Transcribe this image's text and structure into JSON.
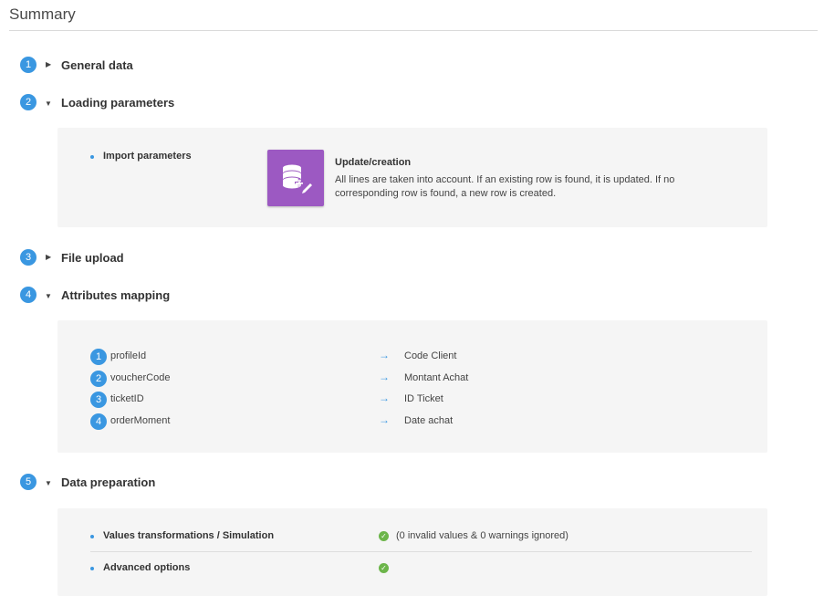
{
  "page": {
    "title": "Summary"
  },
  "sections": [
    {
      "number": "1",
      "title": "General data"
    },
    {
      "number": "2",
      "title": "Loading parameters"
    },
    {
      "number": "3",
      "title": "File upload"
    },
    {
      "number": "4",
      "title": "Attributes mapping"
    },
    {
      "number": "5",
      "title": "Data preparation"
    }
  ],
  "loading": {
    "label": "Import parameters",
    "mode_title": "Update/creation",
    "mode_desc_line1": "All lines are taken into account. If an existing row is found, it is updated. If no",
    "mode_desc_line2": "corresponding row is found, a new row is created."
  },
  "mapping": [
    {
      "number": "1",
      "source": "profileId",
      "target": "Code Client"
    },
    {
      "number": "2",
      "source": "voucherCode",
      "target": "Montant Achat"
    },
    {
      "number": "3",
      "source": "ticketID",
      "target": "ID Ticket"
    },
    {
      "number": "4",
      "source": "orderMoment",
      "target": "Date achat"
    }
  ],
  "preparation": {
    "rows": [
      {
        "label": "Values transformations / Simulation",
        "value": "(0 invalid values & 0 warnings ignored)"
      },
      {
        "label": "Advanced options",
        "value": ""
      }
    ]
  },
  "icons": {
    "caret_collapsed": "caret-right-icon",
    "caret_expanded": "caret-down-icon",
    "arrow": "arrow-right-icon",
    "check": "check-circle-icon",
    "import_mode": "database-plus-edit-icon"
  },
  "colors": {
    "accent": "#3a97e1",
    "import_tile": "#9c59c2",
    "success": "#6cb54a",
    "panel": "#f5f5f5"
  }
}
